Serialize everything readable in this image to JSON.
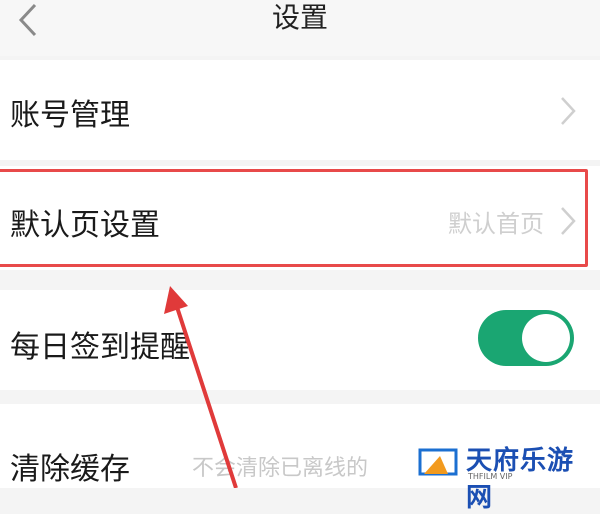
{
  "header": {
    "title": "设置",
    "back_icon": "chevron-left-icon"
  },
  "rows": [
    {
      "label": "账号管理"
    },
    {
      "label": "默认页设置",
      "value": "默认首页"
    },
    {
      "label": "每日签到提醒",
      "toggle_on": true
    },
    {
      "label": "清除缓存",
      "description": "不会清除已离线的"
    }
  ],
  "watermark": {
    "brand": "天府乐游网",
    "sub": "THFILM VIP"
  },
  "colors": {
    "toggle_on": "#1aa672",
    "highlight": "#e84a4a",
    "arrow": "#e03a3a"
  }
}
